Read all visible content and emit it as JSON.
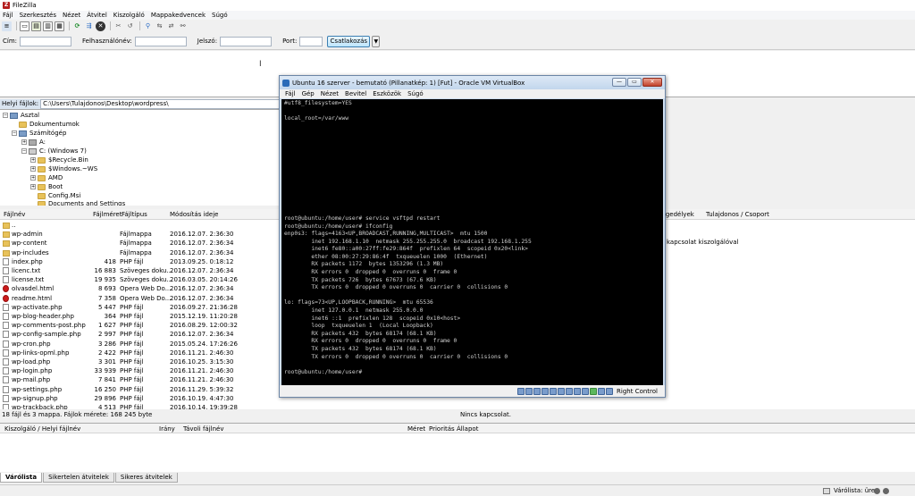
{
  "app": {
    "title": "FileZilla"
  },
  "menu": [
    "Fájl",
    "Szerkesztés",
    "Nézet",
    "Átvitel",
    "Kiszolgáló",
    "Mappakedvencek",
    "Súgó"
  ],
  "quickconnect": {
    "host_label": "Cím:",
    "user_label": "Felhasználónév:",
    "pass_label": "Jelszó:",
    "port_label": "Port:",
    "connect_label": "Csatlakozás",
    "host_value": "",
    "user_value": "",
    "pass_value": "",
    "port_value": ""
  },
  "local": {
    "path_label": "Helyi fájlok:",
    "path_value": "C:\\Users\\Tulajdonos\\Desktop\\wordpress\\",
    "tree": [
      "Asztal",
      "Dokumentumok",
      "Számítógép",
      "A:",
      "C: (Windows 7)",
      "$Recycle.Bin",
      "$Windows.~WS",
      "AMD",
      "Boot",
      "Config.Msi",
      "Documents and Settings"
    ],
    "columns": {
      "name": "Fájlnév",
      "size": "Fájlméret",
      "type": "Fájltípus",
      "modified": "Módosítás ideje"
    },
    "files": [
      {
        "name": "..",
        "size": "",
        "type": "",
        "modified": "",
        "icon": "folder"
      },
      {
        "name": "wp-admin",
        "size": "",
        "type": "Fájlmappa",
        "modified": "2016.12.07. 2:36:30",
        "icon": "folder"
      },
      {
        "name": "wp-content",
        "size": "",
        "type": "Fájlmappa",
        "modified": "2016.12.07. 2:36:34",
        "icon": "folder"
      },
      {
        "name": "wp-includes",
        "size": "",
        "type": "Fájlmappa",
        "modified": "2016.12.07. 2:36:34",
        "icon": "folder"
      },
      {
        "name": "index.php",
        "size": "418",
        "type": "PHP fájl",
        "modified": "2013.09.25. 0:18:12",
        "icon": "file"
      },
      {
        "name": "licenc.txt",
        "size": "16 883",
        "type": "Szöveges doku...",
        "modified": "2016.12.07. 2:36:34",
        "icon": "file"
      },
      {
        "name": "license.txt",
        "size": "19 935",
        "type": "Szöveges doku...",
        "modified": "2016.03.05. 20:14:26",
        "icon": "file"
      },
      {
        "name": "olvasdel.html",
        "size": "8 693",
        "type": "Opera Web Do...",
        "modified": "2016.12.07. 2:36:34",
        "icon": "opera"
      },
      {
        "name": "readme.html",
        "size": "7 358",
        "type": "Opera Web Do...",
        "modified": "2016.12.07. 2:36:34",
        "icon": "opera"
      },
      {
        "name": "wp-activate.php",
        "size": "5 447",
        "type": "PHP fájl",
        "modified": "2016.09.27. 21:36:28",
        "icon": "file"
      },
      {
        "name": "wp-blog-header.php",
        "size": "364",
        "type": "PHP fájl",
        "modified": "2015.12.19. 11:20:28",
        "icon": "file"
      },
      {
        "name": "wp-comments-post.php",
        "size": "1 627",
        "type": "PHP fájl",
        "modified": "2016.08.29. 12:00:32",
        "icon": "file"
      },
      {
        "name": "wp-config-sample.php",
        "size": "2 997",
        "type": "PHP fájl",
        "modified": "2016.12.07. 2:36:34",
        "icon": "file"
      },
      {
        "name": "wp-cron.php",
        "size": "3 286",
        "type": "PHP fájl",
        "modified": "2015.05.24. 17:26:26",
        "icon": "file"
      },
      {
        "name": "wp-links-opml.php",
        "size": "2 422",
        "type": "PHP fájl",
        "modified": "2016.11.21. 2:46:30",
        "icon": "file"
      },
      {
        "name": "wp-load.php",
        "size": "3 301",
        "type": "PHP fájl",
        "modified": "2016.10.25. 3:15:30",
        "icon": "file"
      },
      {
        "name": "wp-login.php",
        "size": "33 939",
        "type": "PHP fájl",
        "modified": "2016.11.21. 2:46:30",
        "icon": "file"
      },
      {
        "name": "wp-mail.php",
        "size": "7 841",
        "type": "PHP fájl",
        "modified": "2016.11.21. 2:46:30",
        "icon": "file"
      },
      {
        "name": "wp-settings.php",
        "size": "16 250",
        "type": "PHP fájl",
        "modified": "2016.11.29. 5:39:32",
        "icon": "file"
      },
      {
        "name": "wp-signup.php",
        "size": "29 896",
        "type": "PHP fájl",
        "modified": "2016.10.19. 4:47:30",
        "icon": "file"
      },
      {
        "name": "wp-trackback.php",
        "size": "4 513",
        "type": "PHP fájl",
        "modified": "2016.10.14. 19:39:28",
        "icon": "file"
      }
    ],
    "status": "18 fájl és 3 mappa. Fájlok mérete: 168 245 byte"
  },
  "remote": {
    "columns": {
      "permissions": "Engedélyek",
      "owner": "Tulajdonos / Csoport"
    },
    "message": "kapcsolat kiszolgálóval",
    "status": "Nincs kapcsolat."
  },
  "queue": {
    "columns": {
      "server": "Kiszolgáló / Helyi fájlnév",
      "direction": "Irány",
      "remote": "Távoli fájlnév",
      "size": "Méret",
      "priority": "Prioritás",
      "status": "Állapot"
    },
    "tabs": [
      "Várólista",
      "Sikertelen átvitelek",
      "Sikeres átvitelek"
    ],
    "footer": "Várólista: üres"
  },
  "vbox": {
    "title": "Ubuntu 16 szerver - bemutató (Pillanatkép: 1) [Fut] - Oracle VM VirtualBox",
    "menu": [
      "Fájl",
      "Gép",
      "Nézet",
      "Bevitel",
      "Eszközök",
      "Súgó"
    ],
    "host_key": "Right Control",
    "terminal": [
      "#utf8_filesystem=YES",
      "",
      "local_root=/var/www",
      "",
      "",
      "",
      "",
      "",
      "",
      "",
      "",
      "",
      "",
      "",
      "",
      "root@ubuntu:/home/user# service vsftpd restart",
      "root@ubuntu:/home/user# ifconfig",
      "enp0s3: flags=4163<UP,BROADCAST,RUNNING,MULTICAST>  mtu 1500",
      "        inet 192.168.1.10  netmask 255.255.255.0  broadcast 192.168.1.255",
      "        inet6 fe80::a00:27ff:fe29:864f  prefixlen 64  scopeid 0x20<link>",
      "        ether 08:00:27:29:86:4f  txqueuelen 1000  (Ethernet)",
      "        RX packets 1172  bytes 1353296 (1.3 MB)",
      "        RX errors 0  dropped 0  overruns 0  frame 0",
      "        TX packets 726  bytes 67673 (67.6 KB)",
      "        TX errors 0  dropped 0 overruns 0  carrier 0  collisions 0",
      "",
      "lo: flags=73<UP,LOOPBACK,RUNNING>  mtu 65536",
      "        inet 127.0.0.1  netmask 255.0.0.0",
      "        inet6 ::1  prefixlen 128  scopeid 0x10<host>",
      "        loop  txqueuelen 1  (Local Loopback)",
      "        RX packets 432  bytes 68174 (68.1 KB)",
      "        RX errors 0  dropped 0  overruns 0  frame 0",
      "        TX packets 432  bytes 68174 (68.1 KB)",
      "        TX errors 0  dropped 0 overruns 0  carrier 0  collisions 0",
      "",
      "root@ubuntu:/home/user#"
    ]
  }
}
